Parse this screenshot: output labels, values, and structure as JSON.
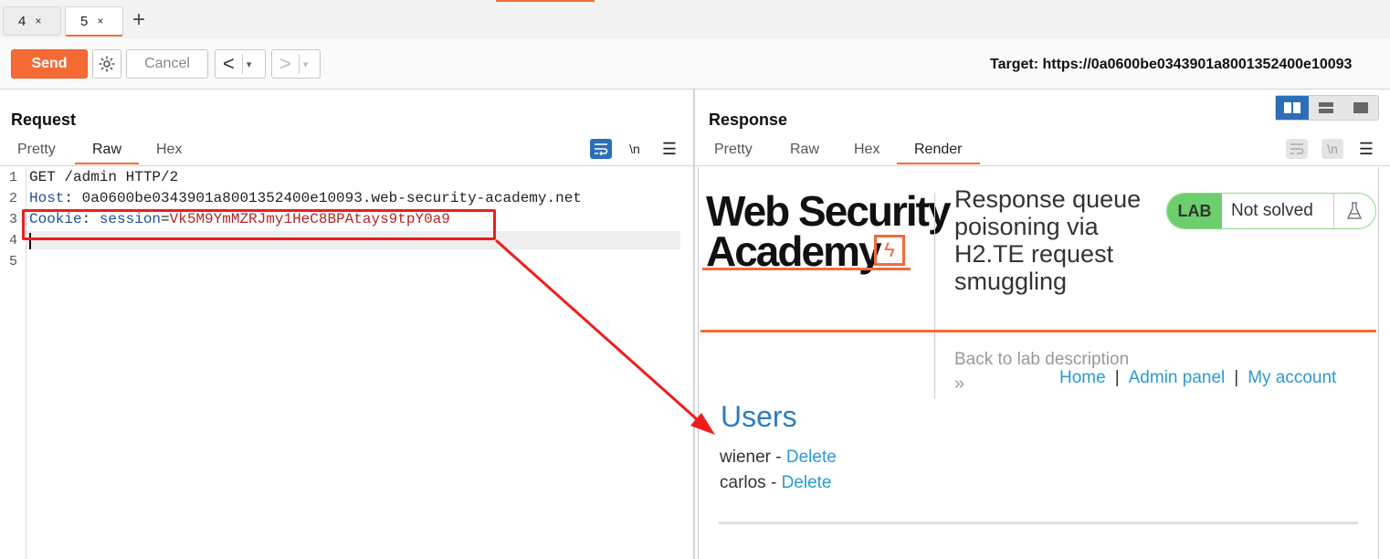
{
  "tabs": [
    {
      "label": "4",
      "close": "×"
    },
    {
      "label": "5",
      "close": "×"
    }
  ],
  "new_tab": "+",
  "toolbar": {
    "send": "Send",
    "cancel": "Cancel",
    "back": "<",
    "forward": ">",
    "dropdown": "▾",
    "target": "Target: https://0a0600be0343901a8001352400e10093"
  },
  "request": {
    "title": "Request",
    "tabs": [
      "Pretty",
      "Raw",
      "Hex"
    ],
    "newline_toggle": "\\n",
    "lines": [
      {
        "n": "1",
        "text": "GET /admin HTTP/2"
      },
      {
        "n": "2",
        "key": "Host",
        "sep": ": ",
        "value": "0a0600be0343901a8001352400e10093.web-security-academy.net"
      },
      {
        "n": "3",
        "key": "Cookie",
        "sep": ": ",
        "cookie_name": "session",
        "eq": "=",
        "cookie_value": "Vk5M9YmMZRJmy1HeC8BPAtays9tpY0a9"
      },
      {
        "n": "4",
        "text": ""
      },
      {
        "n": "5",
        "text": ""
      }
    ]
  },
  "response": {
    "title": "Response",
    "tabs": [
      "Pretty",
      "Raw",
      "Hex",
      "Render"
    ],
    "newline_toggle": "\\n",
    "render": {
      "logo_line1": "Web Security",
      "logo_line2": "Academy",
      "logo_mark": "ϟ",
      "lab_title": "Response queue poisoning via H2.TE request smuggling",
      "badge_lab": "LAB",
      "badge_status": "Not solved",
      "back_link": "Back to lab description",
      "chevrons": "»",
      "nav": [
        "Home",
        "Admin panel",
        "My account"
      ],
      "nav_sep": "|",
      "users_heading": "Users",
      "users": [
        {
          "name": "wiener",
          "dash": " - ",
          "action": "Delete"
        },
        {
          "name": "carlos",
          "dash": " - ",
          "action": "Delete"
        }
      ]
    }
  },
  "colors": {
    "accent": "#f36b3b",
    "send": "#f66a35",
    "link": "#2b9ad1",
    "annotation": "#f01c1c"
  }
}
